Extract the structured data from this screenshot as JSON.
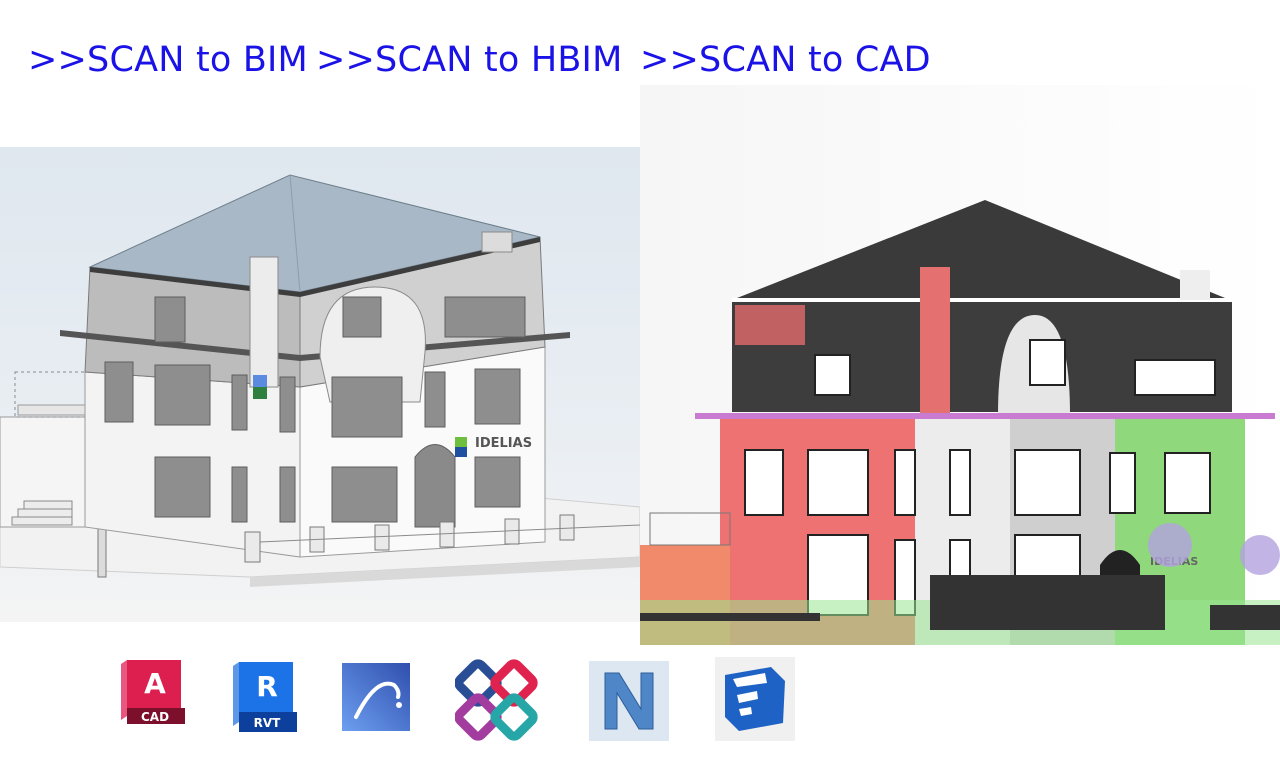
{
  "headings": [
    {
      "label": ">>SCAN to BIM"
    },
    {
      "label": ">>SCAN to HBIM"
    },
    {
      "label": ">>SCAN to CAD"
    }
  ],
  "colors": {
    "heading": "#1a12e6",
    "autocad": "#d6174b",
    "revit": "#1a6fe0",
    "archicad": "#3f63c7",
    "sketchup": "#1d62c4"
  },
  "images": {
    "bim_model": {
      "alt": "BIM model render of a three-storey building",
      "sign_text": "IDELIAS"
    },
    "point_cloud": {
      "alt": "Point cloud scan elevation of the same building",
      "sign_text": "IDELIAS"
    }
  },
  "logos": [
    {
      "name": "autocad",
      "text": "A",
      "badge": "CAD"
    },
    {
      "name": "revit",
      "text": "R",
      "badge": "RVT"
    },
    {
      "name": "archicad",
      "text": "",
      "badge": ""
    },
    {
      "name": "ifc",
      "text": "",
      "badge": ""
    },
    {
      "name": "navisworks",
      "text": "N",
      "badge": ""
    },
    {
      "name": "sketchup",
      "text": "",
      "badge": ""
    }
  ]
}
